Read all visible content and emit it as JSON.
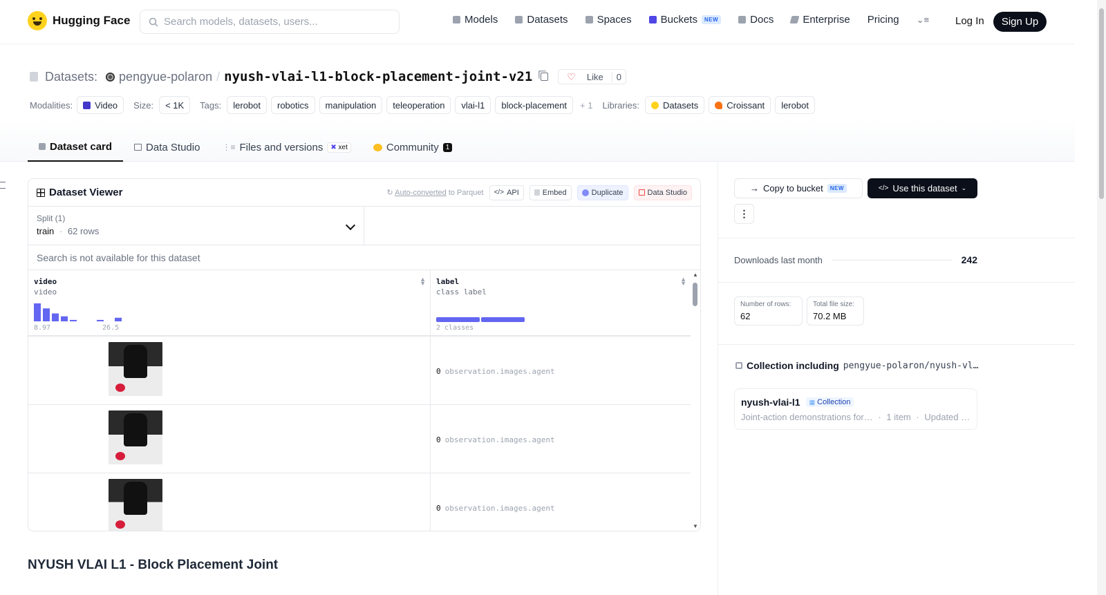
{
  "header": {
    "brand": "Hugging Face",
    "search_placeholder": "Search models, datasets, users...",
    "nav": [
      {
        "label": "Models",
        "icon": "cube-icon"
      },
      {
        "label": "Datasets",
        "icon": "database-icon"
      },
      {
        "label": "Spaces",
        "icon": "grid-icon"
      },
      {
        "label": "Buckets",
        "icon": "bucket-icon",
        "badge": "NEW"
      },
      {
        "label": "Docs",
        "icon": "book-icon"
      },
      {
        "label": "Enterprise",
        "icon": "enterprise-icon"
      },
      {
        "label": "Pricing"
      }
    ],
    "login": "Log In",
    "signup": "Sign Up"
  },
  "repo": {
    "type_label": "Datasets:",
    "owner": "pengyue-polaron",
    "separator": "/",
    "name": "nyush-vlai-l1-block-placement-joint-v21",
    "like_label": "Like",
    "like_count": "0"
  },
  "meta": {
    "modalities_label": "Modalities:",
    "modality": "Video",
    "size_label": "Size:",
    "size": "< 1K",
    "tags_label": "Tags:",
    "tags": [
      "lerobot",
      "robotics",
      "manipulation",
      "teleoperation",
      "vlai-l1",
      "block-placement"
    ],
    "more_tags": "+ 1",
    "libraries_label": "Libraries:",
    "libraries": [
      "Datasets",
      "Croissant",
      "lerobot"
    ]
  },
  "tabs": {
    "dataset_card": "Dataset card",
    "data_studio": "Data Studio",
    "files": "Files and versions",
    "files_badge": "xet",
    "community": "Community",
    "community_count": "1"
  },
  "viewer": {
    "title": "Dataset Viewer",
    "auto_converted": "Auto-converted",
    "to_parquet": "to Parquet",
    "api": "API",
    "embed": "Embed",
    "duplicate": "Duplicate",
    "data_studio": "Data Studio",
    "split_label": "Split (1)",
    "split_value": "train",
    "split_rows": "62 rows",
    "search_note": "Search is not available for this dataset",
    "columns": [
      {
        "name": "video",
        "type": "video",
        "range_min": "8.97",
        "range_max": "26.5"
      },
      {
        "name": "label",
        "type": "class label",
        "summary": "2 classes"
      }
    ],
    "rows": [
      {
        "label_id": "0",
        "label_text": "observation.images.agent"
      },
      {
        "label_id": "0",
        "label_text": "observation.images.agent"
      },
      {
        "label_id": "0",
        "label_text": "observation.images.agent"
      }
    ],
    "histogram": [
      1.0,
      0.72,
      0.44,
      0.28,
      0.08,
      0.0,
      0.0,
      0.08,
      0.0,
      0.2
    ],
    "class_bar": [
      0.5,
      0.5
    ]
  },
  "sidebar": {
    "copy_to_bucket": "Copy to bucket",
    "copy_badge": "NEW",
    "use_dataset": "Use this dataset",
    "downloads_label": "Downloads last month",
    "downloads_value": "242",
    "rows_label": "Number of rows:",
    "rows_value": "62",
    "size_label": "Total file size:",
    "size_value": "70.2 MB",
    "collection_heading": "Collection including",
    "collection_repo": "pengyue-polaron/nyush-vl…",
    "collection_name": "nyush-vlai-l1",
    "collection_badge": "Collection",
    "collection_desc": "Joint-action demonstrations for…",
    "collection_items": "1 item",
    "collection_updated": "Updated …"
  },
  "card": {
    "heading": "NYUSH VLAI L1 - Block Placement Joint"
  },
  "colors": {
    "accent_dark": "#0b0f19",
    "histogram": "#6366f1",
    "like_heart": "#ef4444"
  }
}
